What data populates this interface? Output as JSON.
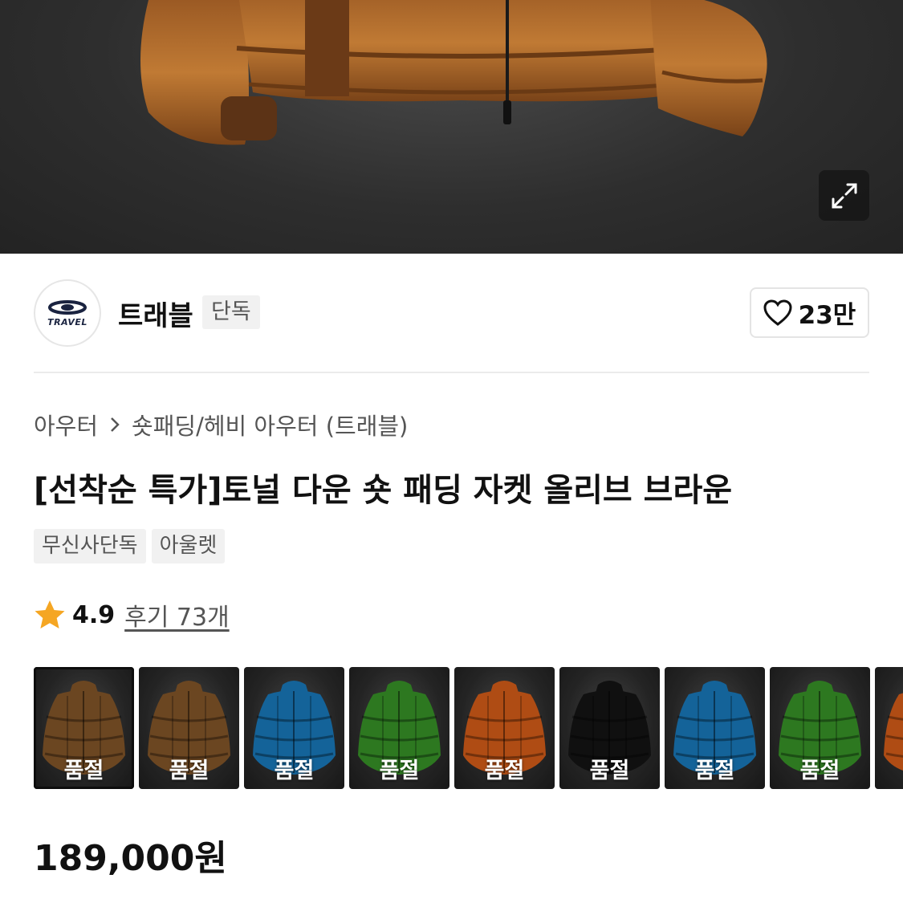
{
  "brand": {
    "logo_text": "TRAVEL",
    "name": "트래블",
    "badge": "단독",
    "like_count": "23만"
  },
  "breadcrumb": [
    "아우터",
    "숏패딩/헤비 아우터 (트래블)"
  ],
  "product": {
    "title": "[선착순 특가]토널 다운 숏 패딩 자켓 올리브 브라운",
    "tags": [
      "무신사단독",
      "아울렛"
    ],
    "rating": "4.9",
    "reviews": "후기 73개",
    "price": "189,000원"
  },
  "swatches": [
    {
      "label": "품절",
      "color": "#8a5a2b",
      "selected": true
    },
    {
      "label": "품절",
      "color": "#8a5a2b",
      "selected": false
    },
    {
      "label": "품절",
      "color": "#1a7fc4",
      "selected": false
    },
    {
      "label": "품절",
      "color": "#3a9a2a",
      "selected": false
    },
    {
      "label": "품절",
      "color": "#e0621a",
      "selected": false
    },
    {
      "label": "품절",
      "color": "#151515",
      "selected": false
    },
    {
      "label": "품절",
      "color": "#1a7fc4",
      "selected": false
    },
    {
      "label": "품절",
      "color": "#3a9a2a",
      "selected": false
    },
    {
      "label": "",
      "color": "#e0621a",
      "selected": false
    }
  ],
  "colors": {
    "star": "#f5a623",
    "hero_bg": "#2e2e2e",
    "jacket_main": "#a8652a"
  },
  "icons": {
    "expand": "expand-icon",
    "heart": "heart-icon",
    "star": "star-icon",
    "chevron": "chevron-right-icon"
  }
}
